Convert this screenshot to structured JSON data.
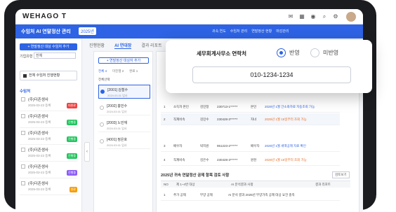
{
  "app": {
    "logo": "WEHAGO T"
  },
  "titlebar": {
    "title": "수임처 AI 연말정산 관리",
    "year": "2025년",
    "chips": [
      "귀속 연도",
      "수임처 관리",
      "연말정산 현황",
      "마감관리"
    ]
  },
  "sidebar": {
    "add_button": "+ 연말정산 대상 수임처 추가",
    "filter_label": "기업유형",
    "filter_value": "전체",
    "all_label": "전체 수임처 진행현황",
    "section_label": "수임처",
    "clients": [
      {
        "name": "(주)더존생사",
        "sub": "2025-03-23 등록",
        "badge": "미완료",
        "badge_color": "#ef4444"
      },
      {
        "name": "(주)더존생사",
        "sub": "2025-03-23 등록",
        "badge": "진행중",
        "badge_color": "#22c55e"
      },
      {
        "name": "(주)더존생사",
        "sub": "2025-03-23 등록",
        "badge": "진행중",
        "badge_color": "#22c55e"
      },
      {
        "name": "(주)더존생사",
        "sub": "2025-03-23 등록",
        "badge": "진행중",
        "badge_color": "#22c55e"
      },
      {
        "name": "(주)더존생사",
        "sub": "2025-03-23 등록",
        "badge": "진행중",
        "badge_color": "#8b5cf6"
      },
      {
        "name": "(주)더존생사",
        "sub": "2025-03-23 등록",
        "badge": "완료",
        "badge_color": "#f59e0b"
      }
    ]
  },
  "tabs": [
    "진행현황",
    "AI 연대장",
    "결과 리포트",
    "자료"
  ],
  "middle": {
    "button": "+ 연말정산 대상자 추가",
    "tabs": [
      "전체 4",
      "미진행 2",
      "완료 1"
    ],
    "select_all": "전체선택",
    "people": [
      {
        "name": "[2001] 김철수",
        "date": "2024.03.01 입사"
      },
      {
        "name": "[2002] 홍민수",
        "date": "2024.03.01 입사"
      },
      {
        "name": "[2003] 노민재",
        "date": "2024.03.01 입사"
      },
      {
        "name": "[4001] 정은호",
        "date": "2024.03.01 입사"
      }
    ]
  },
  "table": {
    "rows": [
      {
        "no": "1",
        "rel": "소득자 본인",
        "name": "김민정",
        "id": "230713-1******",
        "type": "본인",
        "note": "2025년 1월 간소화자료 자동조회 가능"
      },
      {
        "no": "2",
        "rel": "직계비속",
        "name": "김민수",
        "id": "230428-3******",
        "type": "자녀",
        "note": "2025년 1월 15일부터 조회 가능"
      },
      {
        "no": "3",
        "rel": "배우자",
        "name": "박지원",
        "id": "951223-2******",
        "type": "배우자",
        "note": "2025년 1월 세액공제 자료 확인"
      },
      {
        "no": "4",
        "rel": "직계비속",
        "name": "김은수",
        "id": "230428-3******",
        "type": "원천",
        "note": "2025년 1월 15일부터 조회 가능"
      }
    ],
    "section2_title": "2025년 귀속 연말정산 공제 항목 검토 사항",
    "section2_button": "검토보기",
    "section2_headers": [
      "NO",
      "제 1~4번 대상",
      "AI 분석결과 사항",
      "결과 리포트"
    ],
    "section2_row": {
      "no": "1",
      "cat": "추가 공제",
      "name": "부양 공제",
      "detail": "AI 분석 결과 2025년 부양가족 공제 대상 요건 충족"
    }
  },
  "popup": {
    "title": "세무회계사무소 연락처",
    "option_on": "반영",
    "option_off": "미반영",
    "phone": "010-1234-1234"
  }
}
